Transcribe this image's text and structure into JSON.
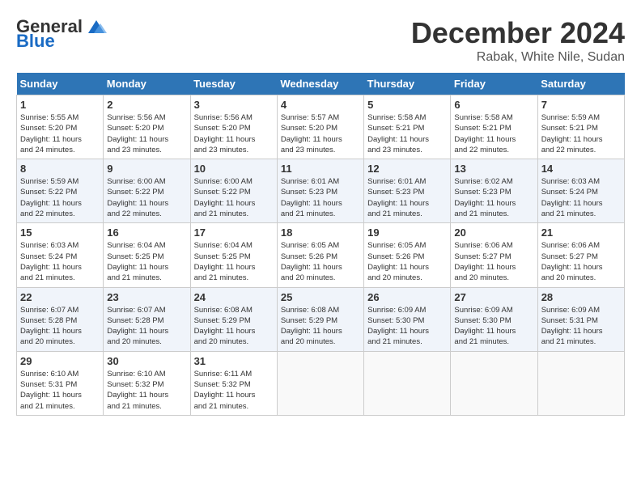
{
  "logo": {
    "general": "General",
    "blue": "Blue"
  },
  "title": {
    "month_year": "December 2024",
    "location": "Rabak, White Nile, Sudan"
  },
  "headers": [
    "Sunday",
    "Monday",
    "Tuesday",
    "Wednesday",
    "Thursday",
    "Friday",
    "Saturday"
  ],
  "weeks": [
    [
      {
        "day": "1",
        "sunrise": "5:55 AM",
        "sunset": "5:20 PM",
        "daylight": "11 hours and 24 minutes."
      },
      {
        "day": "2",
        "sunrise": "5:56 AM",
        "sunset": "5:20 PM",
        "daylight": "11 hours and 23 minutes."
      },
      {
        "day": "3",
        "sunrise": "5:56 AM",
        "sunset": "5:20 PM",
        "daylight": "11 hours and 23 minutes."
      },
      {
        "day": "4",
        "sunrise": "5:57 AM",
        "sunset": "5:20 PM",
        "daylight": "11 hours and 23 minutes."
      },
      {
        "day": "5",
        "sunrise": "5:58 AM",
        "sunset": "5:21 PM",
        "daylight": "11 hours and 23 minutes."
      },
      {
        "day": "6",
        "sunrise": "5:58 AM",
        "sunset": "5:21 PM",
        "daylight": "11 hours and 22 minutes."
      },
      {
        "day": "7",
        "sunrise": "5:59 AM",
        "sunset": "5:21 PM",
        "daylight": "11 hours and 22 minutes."
      }
    ],
    [
      {
        "day": "8",
        "sunrise": "5:59 AM",
        "sunset": "5:22 PM",
        "daylight": "11 hours and 22 minutes."
      },
      {
        "day": "9",
        "sunrise": "6:00 AM",
        "sunset": "5:22 PM",
        "daylight": "11 hours and 22 minutes."
      },
      {
        "day": "10",
        "sunrise": "6:00 AM",
        "sunset": "5:22 PM",
        "daylight": "11 hours and 21 minutes."
      },
      {
        "day": "11",
        "sunrise": "6:01 AM",
        "sunset": "5:23 PM",
        "daylight": "11 hours and 21 minutes."
      },
      {
        "day": "12",
        "sunrise": "6:01 AM",
        "sunset": "5:23 PM",
        "daylight": "11 hours and 21 minutes."
      },
      {
        "day": "13",
        "sunrise": "6:02 AM",
        "sunset": "5:23 PM",
        "daylight": "11 hours and 21 minutes."
      },
      {
        "day": "14",
        "sunrise": "6:03 AM",
        "sunset": "5:24 PM",
        "daylight": "11 hours and 21 minutes."
      }
    ],
    [
      {
        "day": "15",
        "sunrise": "6:03 AM",
        "sunset": "5:24 PM",
        "daylight": "11 hours and 21 minutes."
      },
      {
        "day": "16",
        "sunrise": "6:04 AM",
        "sunset": "5:25 PM",
        "daylight": "11 hours and 21 minutes."
      },
      {
        "day": "17",
        "sunrise": "6:04 AM",
        "sunset": "5:25 PM",
        "daylight": "11 hours and 21 minutes."
      },
      {
        "day": "18",
        "sunrise": "6:05 AM",
        "sunset": "5:26 PM",
        "daylight": "11 hours and 20 minutes."
      },
      {
        "day": "19",
        "sunrise": "6:05 AM",
        "sunset": "5:26 PM",
        "daylight": "11 hours and 20 minutes."
      },
      {
        "day": "20",
        "sunrise": "6:06 AM",
        "sunset": "5:27 PM",
        "daylight": "11 hours and 20 minutes."
      },
      {
        "day": "21",
        "sunrise": "6:06 AM",
        "sunset": "5:27 PM",
        "daylight": "11 hours and 20 minutes."
      }
    ],
    [
      {
        "day": "22",
        "sunrise": "6:07 AM",
        "sunset": "5:28 PM",
        "daylight": "11 hours and 20 minutes."
      },
      {
        "day": "23",
        "sunrise": "6:07 AM",
        "sunset": "5:28 PM",
        "daylight": "11 hours and 20 minutes."
      },
      {
        "day": "24",
        "sunrise": "6:08 AM",
        "sunset": "5:29 PM",
        "daylight": "11 hours and 20 minutes."
      },
      {
        "day": "25",
        "sunrise": "6:08 AM",
        "sunset": "5:29 PM",
        "daylight": "11 hours and 20 minutes."
      },
      {
        "day": "26",
        "sunrise": "6:09 AM",
        "sunset": "5:30 PM",
        "daylight": "11 hours and 21 minutes."
      },
      {
        "day": "27",
        "sunrise": "6:09 AM",
        "sunset": "5:30 PM",
        "daylight": "11 hours and 21 minutes."
      },
      {
        "day": "28",
        "sunrise": "6:09 AM",
        "sunset": "5:31 PM",
        "daylight": "11 hours and 21 minutes."
      }
    ],
    [
      {
        "day": "29",
        "sunrise": "6:10 AM",
        "sunset": "5:31 PM",
        "daylight": "11 hours and 21 minutes."
      },
      {
        "day": "30",
        "sunrise": "6:10 AM",
        "sunset": "5:32 PM",
        "daylight": "11 hours and 21 minutes."
      },
      {
        "day": "31",
        "sunrise": "6:11 AM",
        "sunset": "5:32 PM",
        "daylight": "11 hours and 21 minutes."
      },
      null,
      null,
      null,
      null
    ]
  ]
}
